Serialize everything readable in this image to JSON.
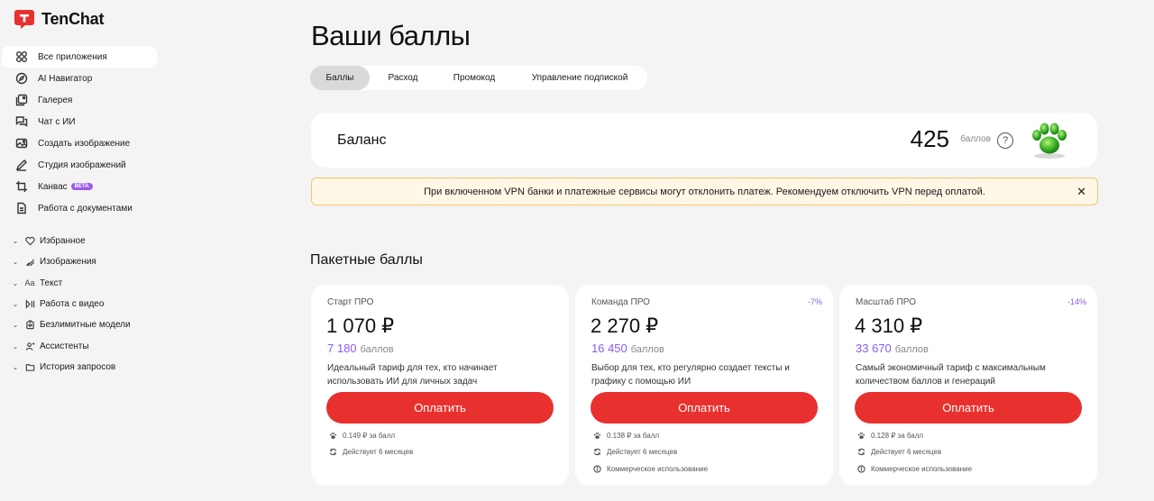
{
  "app": {
    "name": "TenChat",
    "brand_color": "#e8312f",
    "accent_purple": "#8a5cf6"
  },
  "sidebar": {
    "items": [
      {
        "label": "Все приложения",
        "icon": "grid-icon",
        "active": true
      },
      {
        "label": "AI Навигатор",
        "icon": "compass-icon"
      },
      {
        "label": "Галерея",
        "icon": "gallery-icon"
      },
      {
        "label": "Чат с ИИ",
        "icon": "chat-icon"
      },
      {
        "label": "Создать изображение",
        "icon": "image-plus-icon"
      },
      {
        "label": "Студия изображений",
        "icon": "pen-icon"
      },
      {
        "label": "Канвас",
        "icon": "crop-icon",
        "badge": "BETA"
      },
      {
        "label": "Работа с документами",
        "icon": "document-icon"
      }
    ],
    "groups": [
      {
        "label": "Избранное",
        "icon": "heart-icon"
      },
      {
        "label": "Изображения",
        "icon": "brush-icon"
      },
      {
        "label": "Текст",
        "icon": "text-icon",
        "icon_text": "Aa"
      },
      {
        "label": "Работа с видео",
        "icon": "play-pause-icon"
      },
      {
        "label": "Безлимитные модели",
        "icon": "infinity-icon"
      },
      {
        "label": "Ассистенты",
        "icon": "assistant-icon"
      },
      {
        "label": "История запросов",
        "icon": "folder-icon"
      }
    ]
  },
  "page": {
    "title": "Ваши баллы"
  },
  "tabs": [
    {
      "label": "Баллы",
      "active": true
    },
    {
      "label": "Расход"
    },
    {
      "label": "Промокод"
    },
    {
      "label": "Управление подпиской"
    }
  ],
  "balance": {
    "label": "Баланс",
    "value": "425",
    "unit": "баллов",
    "help": "?"
  },
  "alert": {
    "text": "При включенном VPN банки и платежные сервисы могут отклонить платеж. Рекомендуем отключить VPN перед оплатой.",
    "close": "✕"
  },
  "packages": {
    "title": "Пакетные баллы",
    "cards": [
      {
        "name": "Старт ПРО",
        "discount": "",
        "price": "1 070 ₽",
        "points": "7 180",
        "points_unit": "баллов",
        "desc": "Идеальный тариф для тех, кто начинает использовать ИИ для личных задач",
        "button": "Оплатить",
        "features": [
          "0.149 ₽ за балл",
          "Действует 6 месяцев"
        ]
      },
      {
        "name": "Команда ПРО",
        "discount": "-7%",
        "price": "2 270 ₽",
        "points": "16 450",
        "points_unit": "баллов",
        "desc": "Выбор для тех, кто регулярно создает тексты и графику с помощью ИИ",
        "button": "Оплатить",
        "features": [
          "0.138 ₽ за балл",
          "Действует 6 месяцев",
          "Коммерческое использование"
        ]
      },
      {
        "name": "Масштаб ПРО",
        "discount": "-14%",
        "price": "4 310 ₽",
        "points": "33 670",
        "points_unit": "баллов",
        "desc": "Самый экономичный тариф с максимальным количеством баллов и генераций",
        "button": "Оплатить",
        "features": [
          "0.128 ₽ за балл",
          "Действует 6 месяцев",
          "Коммерческое использование"
        ]
      }
    ]
  }
}
